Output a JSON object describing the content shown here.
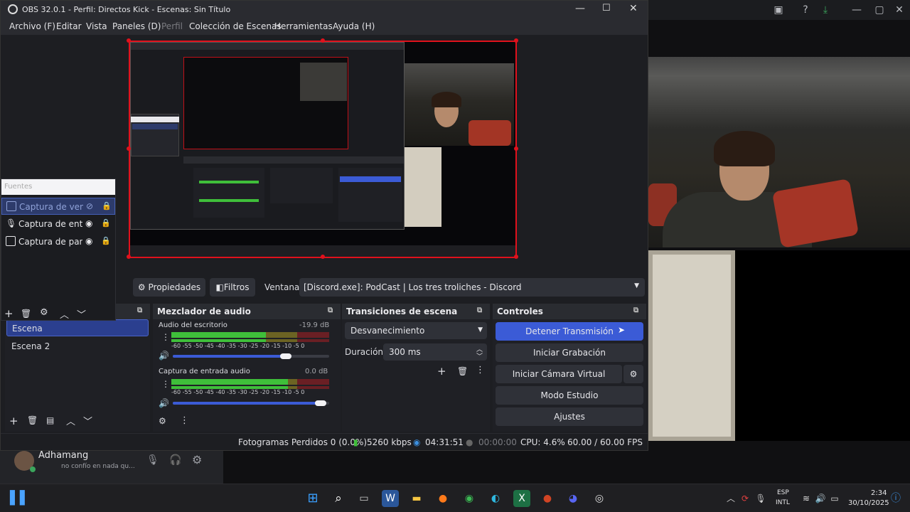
{
  "obs": {
    "title": "OBS 32.0.1 - Perfil: Directos Kick - Escenas: Sin Título",
    "menu": [
      "Archivo (F)",
      "Editar",
      "Vista",
      "Paneles (D)",
      "Perfil",
      "Colección de Escenas",
      "Herramientas",
      "Ayuda (H)"
    ],
    "fuentes": {
      "header": "Fuentes",
      "items": [
        {
          "label": "Captura de ventana",
          "selected": true
        },
        {
          "label": "Captura de entrada",
          "selected": false
        },
        {
          "label": "Captura de pantalla",
          "selected": false
        }
      ]
    },
    "props_bar": {
      "properties": "Propiedades",
      "filters": "Filtros",
      "window_label": "Ventana",
      "window_value": "[Discord.exe]: PodCast | Los tres troliches - Discord"
    },
    "scenes": {
      "items": [
        "Escena",
        "Escena 2"
      ],
      "selected": "Escena"
    },
    "mixer": {
      "title": "Mezclador de audio",
      "channels": [
        {
          "name": "Audio del escritorio",
          "db": "-19.9 dB",
          "level": 0.6,
          "volume": 0.76
        },
        {
          "name": "Captura de entrada audio",
          "db": "0.0 dB",
          "level": 0.74,
          "volume": 0.98
        }
      ],
      "ticks": "-60 -55 -50 -45 -40 -35 -30 -25 -20 -15 -10 -5 0"
    },
    "transitions": {
      "title": "Transiciones de escena",
      "type": "Desvanecimiento",
      "duration_label": "Duración",
      "duration_value": "300 ms"
    },
    "controls": {
      "title": "Controles",
      "stop_stream": "Detener Transmisión",
      "start_recording": "Iniciar Grabación",
      "start_vcam": "Iniciar Cámara Virtual",
      "studio_mode": "Modo Estudio",
      "settings": "Ajustes"
    },
    "status": {
      "dropped": "Fotogramas Perdidos 0 (0.0%)",
      "bitrate": "5260 kbps",
      "stream_time": "04:31:51",
      "rec_time": "00:00:00",
      "cpu": "CPU: 4.6%",
      "fps": "60.00 / 60.00 FPS"
    }
  },
  "discord": {
    "username": "Adhamang",
    "status": "no confío en nada qu..."
  },
  "taskbar": {
    "lang_top": "ESP",
    "lang_bottom": "INTL",
    "time": "2:34",
    "date": "30/10/2025"
  },
  "colors": {
    "accent": "#3b5bd6",
    "red_border": "#e0111c",
    "dock_bg": "#1f2025"
  }
}
